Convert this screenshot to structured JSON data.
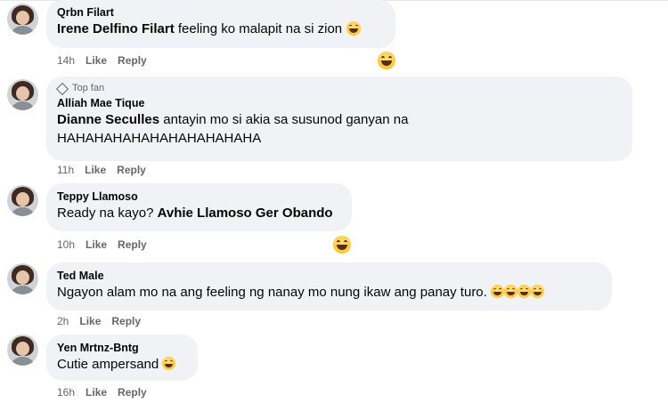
{
  "comments": [
    {
      "author": "Qrbn Filart",
      "mention": "Irene Delfino Filart",
      "text": " feeling ko malapit na si zion",
      "time": "14h",
      "like": "Like",
      "reply": "Reply",
      "reaction": "haha"
    },
    {
      "badge": "Top fan",
      "author": "Alliah Mae Tique",
      "mention": "Dianne Seculles",
      "text": " antayin mo si akia sa susunod ganyan na HAHAHAHAHAHAHAHAHAHAHA",
      "time": "11h",
      "like": "Like",
      "reply": "Reply"
    },
    {
      "author": "Teppy Llamoso",
      "text": "Ready na kayo? ",
      "mention": "Avhie Llamoso Ger Obando",
      "time": "10h",
      "like": "Like",
      "reply": "Reply",
      "reaction": "haha"
    },
    {
      "author": "Ted Male",
      "text": "Ngayon alam mo na ang feeling ng nanay mo nung ikaw ang panay turo.",
      "time": "2h",
      "like": "Like",
      "reply": "Reply"
    },
    {
      "author": "Yen Mrtnz-Bntg",
      "text": "Cutie ampersand",
      "time": "16h",
      "like": "Like",
      "reply": "Reply"
    }
  ],
  "colors": {
    "bubble": "#f0f2f5",
    "meta_text": "#65676b",
    "name_text": "#050505",
    "emoji": "#ffcd3a"
  },
  "icons": [
    "diamond-icon",
    "haha-reaction-icon",
    "laughing-emoji-icon",
    "grinning-emoji-icon"
  ]
}
